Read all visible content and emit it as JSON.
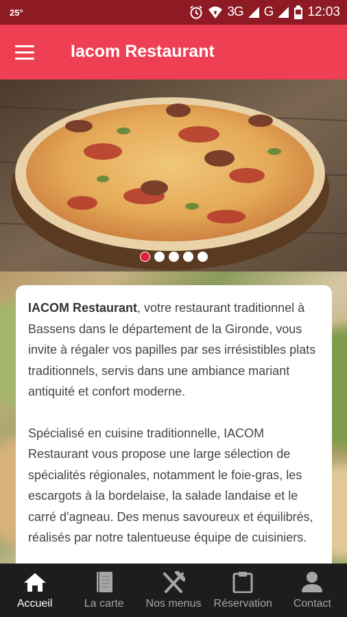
{
  "status_bar": {
    "temperature": "25°",
    "network_1": "3G",
    "network_2": "G",
    "time": "12:03"
  },
  "app_bar": {
    "title": "Iacom Restaurant",
    "menu_icon": "hamburger-menu-icon"
  },
  "carousel": {
    "slide_count": 5,
    "active_index": 0
  },
  "intro": {
    "brand": "IACOM Restaurant",
    "paragraph_1_rest": ", votre restaurant traditionnel à Bassens dans le département de la Gironde, vous invite à régaler vos papilles par ses irrésistibles plats traditionnels, servis dans une ambiance mariant antiquité et confort moderne.",
    "paragraph_2": "Spécialisé en cuisine traditionnelle, IACOM Restaurant vous propose une large sélection de spécialités régionales, notamment le foie-gras, les escargots à la bordelaise, la salade landaise et le carré d'agneau. Des menus savoureux et équilibrés, réalisés par notre talentueuse équipe de cuisiniers."
  },
  "bottom_nav": {
    "items": [
      {
        "label": "Accueil",
        "icon": "home-icon",
        "active": true
      },
      {
        "label": "La carte",
        "icon": "book-icon",
        "active": false
      },
      {
        "label": "Nos menus",
        "icon": "fork-knife-icon",
        "active": false
      },
      {
        "label": "Réservation",
        "icon": "clipboard-icon",
        "active": false
      },
      {
        "label": "Contact",
        "icon": "person-icon",
        "active": false
      }
    ]
  },
  "colors": {
    "status_bar": "#8e1a24",
    "app_bar": "#ef3f53",
    "dot_active": "#e3223a"
  }
}
